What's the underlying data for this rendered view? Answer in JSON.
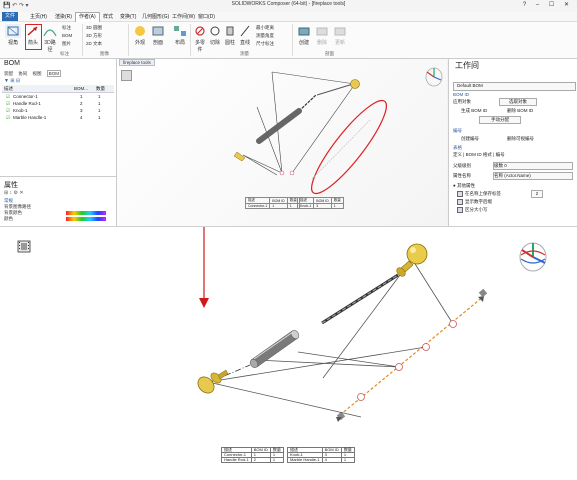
{
  "app": {
    "title": "SOLIDWORKS Composer (64-bit) - [fireplace tools]",
    "window_controls": "? – ☐ ✕",
    "quick_access": "💾 ↶ ↷ ▾"
  },
  "menu": {
    "file": "文件",
    "items": [
      "主页(H)",
      "渲染(R)",
      "作者(A)",
      "样式",
      "变换(T)",
      "几何图形(G)",
      "工作间(W)",
      "窗口(D)"
    ]
  },
  "ribbon": {
    "big_buttons": [
      "视角",
      "箭头",
      "3D路径",
      "外观",
      "剖面",
      "布局",
      "多零件",
      "切除",
      "圆柱",
      "直线",
      "创建",
      "删除",
      "更新"
    ],
    "rows": [
      [
        "标注",
        "3D 圆圈",
        "最小距离"
      ],
      [
        "BOM",
        "3D 方形",
        "测量角度"
      ],
      [
        "图片",
        "2D 文本",
        "尺寸标注"
      ]
    ],
    "groups": [
      "标注",
      "图像",
      "测量",
      "剖面"
    ]
  },
  "left_panel": {
    "title": "BOM",
    "tabs": [
      "装配",
      "协同",
      "视图",
      "BOM"
    ],
    "columns": [
      "描述",
      "BOM...",
      "数量"
    ],
    "rows": [
      {
        "name": "Connector-1",
        "id": "1",
        "qty": "1"
      },
      {
        "name": "Handle Rod-1",
        "id": "2",
        "qty": "1"
      },
      {
        "name": "Knob-1",
        "id": "3",
        "qty": "1"
      },
      {
        "name": "Marble Handle-1",
        "id": "4",
        "qty": "1"
      }
    ],
    "props_title": "属性",
    "props_tools": "⊞ ↕ ⚙ ✕",
    "props_rows": [
      "常规",
      "背景图像路径",
      "背景颜色",
      "颜色",
      "背景样式"
    ]
  },
  "viewport": {
    "tab": "fireplace tools"
  },
  "right_panel": {
    "title": "工作间",
    "selector": "Default BOM",
    "section_bom_id": "BOM ID",
    "apply_label": "应用对象",
    "select_objects_button": "选取对象",
    "generate": "生成  BOM ID",
    "delete": "删除  BOM ID",
    "manual_button": "手动分配",
    "section_numbering": "编号",
    "create_number": "创建编号",
    "delete_number": "删除可视编号",
    "section_table": "表格",
    "table_tabs": [
      "定义",
      "BOM ID 格式",
      "编号"
    ],
    "level_label": "父级级别",
    "level_value": "级数 0",
    "attr_label": "属性名称",
    "attr_value": "名称 (Actor.Name)",
    "other_attrs": "● 其他属性",
    "check1": "在名称上保存标签",
    "check1_value": "2",
    "check2": "显示数字后缀",
    "check3": "区分大小写"
  },
  "lower_table_top": {
    "headers": [
      "描述",
      "BOM ID",
      "数量"
    ],
    "rows": [
      [
        "Connector-1",
        "1",
        "1"
      ],
      [
        "Handle Rod-1",
        "2",
        "1"
      ]
    ]
  },
  "lower_table_right": {
    "headers": [
      "描述",
      "BOM ID",
      "数量"
    ],
    "rows": [
      [
        "Knob-1",
        "3",
        "1"
      ],
      [
        "Marble Handle-1",
        "4",
        "1"
      ]
    ]
  },
  "return_mark": "↵"
}
